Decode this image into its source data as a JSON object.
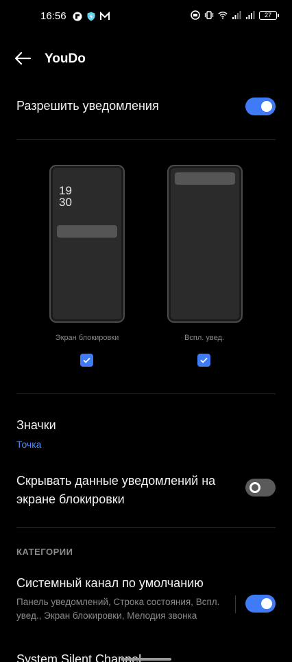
{
  "status_bar": {
    "time": "16:56",
    "battery": "27",
    "left_icons": [
      "app-notification-icon",
      "shield-vpn-icon",
      "mail-icon"
    ],
    "right_icons": [
      "data-saver-icon",
      "vibrate-icon",
      "wifi-icon",
      "signal-icon",
      "signal-icon",
      "battery-icon"
    ]
  },
  "header": {
    "title": "YouDo"
  },
  "allow": {
    "label": "Разрешить уведомления",
    "enabled": true
  },
  "previews": {
    "lockscreen": {
      "clock_h": "19",
      "clock_m": "30",
      "label": "Экран блокировки",
      "checked": true
    },
    "banner": {
      "label": "Вспл. увед.",
      "checked": true
    }
  },
  "badges": {
    "label": "Значки",
    "value": "Точка"
  },
  "hide_sensitive": {
    "label": "Скрывать данные уведомлений на экране блокировки",
    "enabled": false
  },
  "categories": {
    "header": "КАТЕГОРИИ",
    "items": [
      {
        "label": "Системный канал по умолчанию",
        "desc": "Панель уведомлений, Строка состояния, Вспл. увед., Экран блокировки, Мелодия звонка",
        "enabled": true
      },
      {
        "label": "System Silent Channel"
      }
    ]
  },
  "colors": {
    "accent": "#3f7bf5",
    "link": "#4f8bff",
    "background": "#000000"
  }
}
